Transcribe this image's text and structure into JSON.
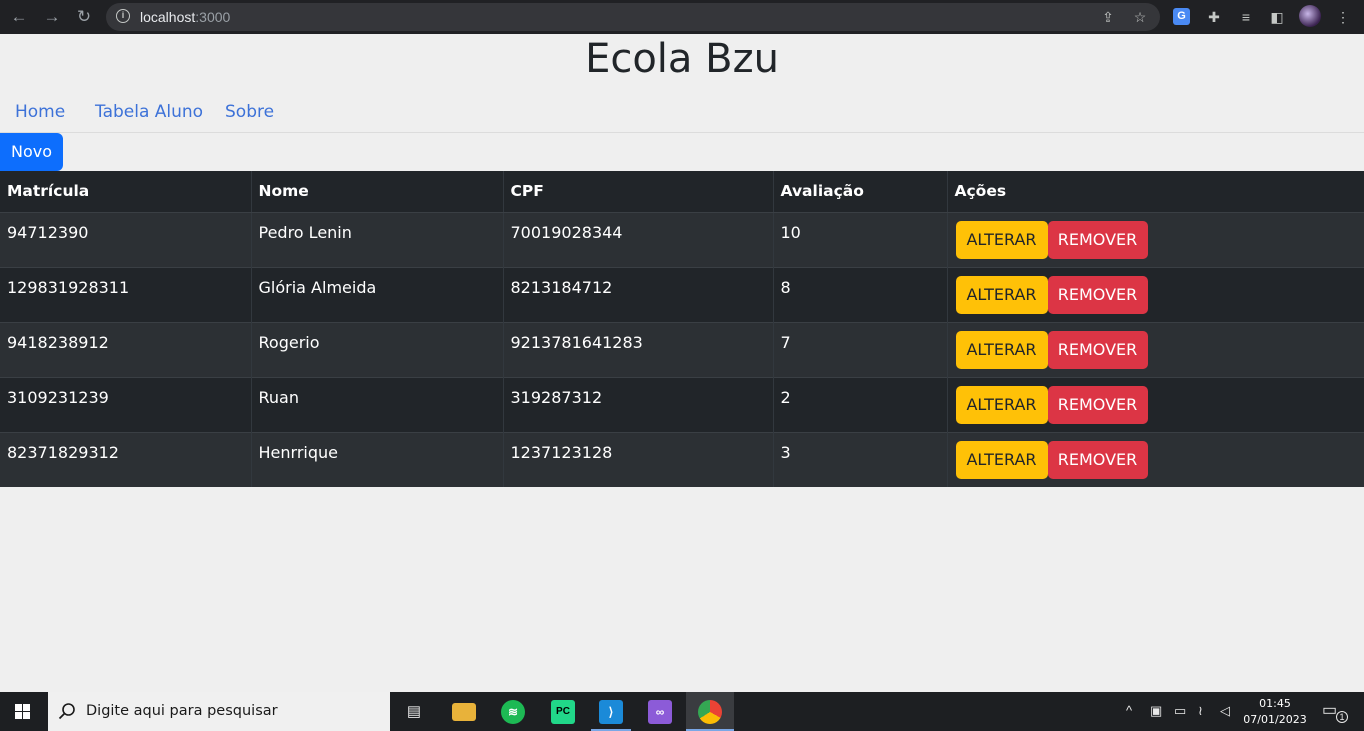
{
  "browser": {
    "url_host": "localhost",
    "url_port": ":3000",
    "icons": [
      "back-icon",
      "forward-icon",
      "reload-icon",
      "info-icon",
      "share-icon",
      "star-icon",
      "translate-icon",
      "puzzle-icon",
      "media-icon",
      "sidepanel-icon",
      "avatar",
      "kebab-menu-icon"
    ]
  },
  "page": {
    "title": "Ecola Bzu",
    "nav": [
      {
        "label": "Home"
      },
      {
        "label": "Tabela Aluno"
      },
      {
        "label": "Sobre"
      }
    ],
    "new_button": "Novo"
  },
  "table": {
    "headers": [
      "Matrícula",
      "Nome",
      "CPF",
      "Avaliação",
      "Ações"
    ],
    "rows": [
      {
        "matricula": "94712390",
        "nome": "Pedro Lenin",
        "cpf": "70019028344",
        "avaliacao": "10"
      },
      {
        "matricula": "129831928311",
        "nome": "Glória Almeida",
        "cpf": "8213184712",
        "avaliacao": "8"
      },
      {
        "matricula": "9418238912",
        "nome": "Rogerio",
        "cpf": "9213781641283",
        "avaliacao": "7"
      },
      {
        "matricula": "3109231239",
        "nome": "Ruan",
        "cpf": "319287312",
        "avaliacao": "2"
      },
      {
        "matricula": "82371829312",
        "nome": "Henrrique",
        "cpf": "1237123128",
        "avaliacao": "3"
      }
    ],
    "alter_label": "ALTERAR",
    "remove_label": "REMOVER"
  },
  "taskbar": {
    "search_placeholder": "Digite aqui para pesquisar",
    "time": "01:45",
    "date": "07/01/2023",
    "notification_count": "1"
  },
  "colors": {
    "primary": "#0d6efd",
    "warning": "#ffc107",
    "danger": "#dc3545",
    "table_dark": "#212529",
    "table_stripe": "#2c3034",
    "link": "#3d72d8"
  }
}
